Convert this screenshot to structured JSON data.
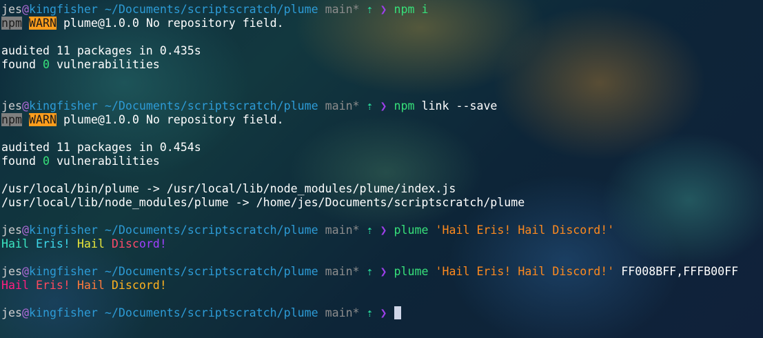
{
  "prompt": {
    "user": "jes",
    "at": "@",
    "host": "kingfisher",
    "path": "~/Documents/scriptscratch/plume",
    "branch": "main*",
    "arrow": "⇡",
    "symbol": "❯"
  },
  "cmd1": "npm i",
  "cmd2_a": "npm",
  "cmd2_b": "link --save",
  "cmd3_a": "plume",
  "cmd3_b": "'Hail Eris! Hail Discord!'",
  "cmd4_a": "plume",
  "cmd4_b": "'Hail Eris! Hail Discord!'",
  "cmd4_c": "FF008BFF,FFFB00FF",
  "warn_npm": "npm",
  "warn_tag": "WARN",
  "warn_msg": " plume@1.0.0 No repository field.",
  "audit1": "audited 11 packages in 0.435s",
  "audit2": "audited 11 packages in 0.454s",
  "found_pre": "found ",
  "found_zero": "0",
  "found_post": " vulnerabilities",
  "link1": "/usr/local/bin/plume -> /usr/local/lib/node_modules/plume/index.js",
  "link2": "/usr/local/lib/node_modules/plume -> /home/jes/Documents/scriptscratch/plume",
  "out1": [
    {
      "t": "Hail ",
      "c": "#3be6c3"
    },
    {
      "t": "Eris! ",
      "c": "#3ed7ea"
    },
    {
      "t": "Hail ",
      "c": "#e8e63a"
    },
    {
      "t": "Disc",
      "c": "#ff4a6a"
    },
    {
      "t": "ord!",
      "c": "#a040ff"
    }
  ],
  "out2": [
    {
      "t": "Hail ",
      "c": "#ff1f80"
    },
    {
      "t": "Eris! ",
      "c": "#ff4a5e"
    },
    {
      "t": "Hail ",
      "c": "#ff7a3c"
    },
    {
      "t": "Discord!",
      "c": "#ffb21e"
    }
  ]
}
